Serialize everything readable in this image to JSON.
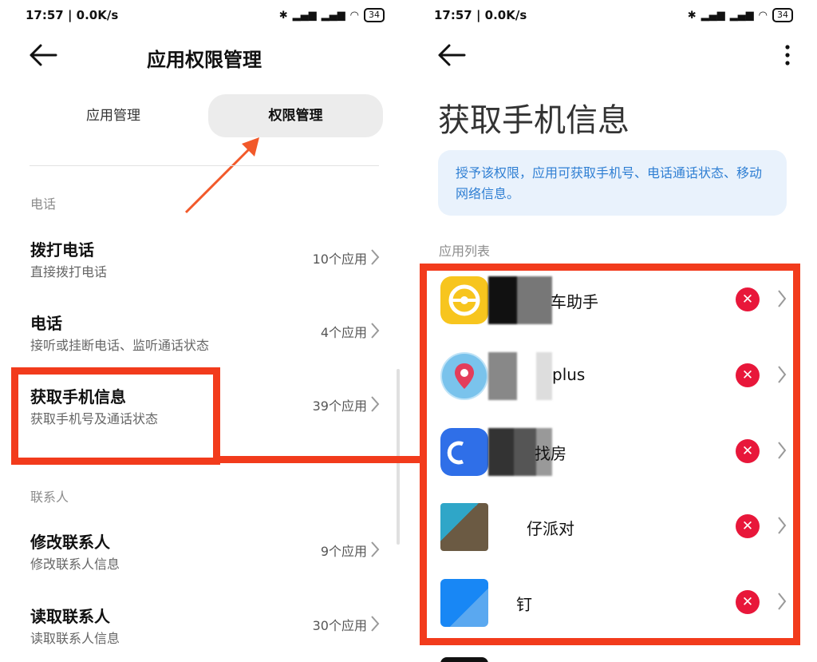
{
  "left": {
    "status": {
      "time": "17:57 | 0.0K/s",
      "battery": "34"
    },
    "title": "应用权限管理",
    "tabs": [
      {
        "label": "应用管理"
      },
      {
        "label": "权限管理"
      }
    ],
    "sections": [
      {
        "label": "电话"
      },
      {
        "label": "联系人"
      }
    ],
    "rows": [
      {
        "name": "拨打电话",
        "desc": "直接拨打电话",
        "count": "10个应用"
      },
      {
        "name": "电话",
        "desc": "接听或挂断电话、监听通话状态",
        "count": "4个应用"
      },
      {
        "name": "获取手机信息",
        "desc": "获取手机号及通话状态",
        "count": "39个应用"
      },
      {
        "name": "修改联系人",
        "desc": "修改联系人信息",
        "count": "9个应用"
      },
      {
        "name": "读取联系人",
        "desc": "读取联系人信息",
        "count": "30个应用"
      }
    ]
  },
  "right": {
    "status": {
      "time": "17:57 | 0.0K/s",
      "battery": "34"
    },
    "title": "获取手机信息",
    "info": "授予该权限，应用可获取手机号、电话通话状态、移动网络信息。",
    "list_label": "应用列表",
    "apps": [
      {
        "label": "车助手",
        "icon": "car-steering-app-icon"
      },
      {
        "label": "plus",
        "icon": "map-pin-app-icon"
      },
      {
        "label": "找房",
        "icon": "house-search-app-icon"
      },
      {
        "label": "仔派对",
        "icon": "game-app-icon"
      },
      {
        "label": "钉",
        "icon": "dingtalk-app-icon"
      }
    ],
    "revoke_symbol": "✕"
  },
  "colors": {
    "highlight": "#f23b1c",
    "revoke": "#e8173a",
    "info_text": "#2f7fd3",
    "info_bg": "#e9f2fc"
  }
}
